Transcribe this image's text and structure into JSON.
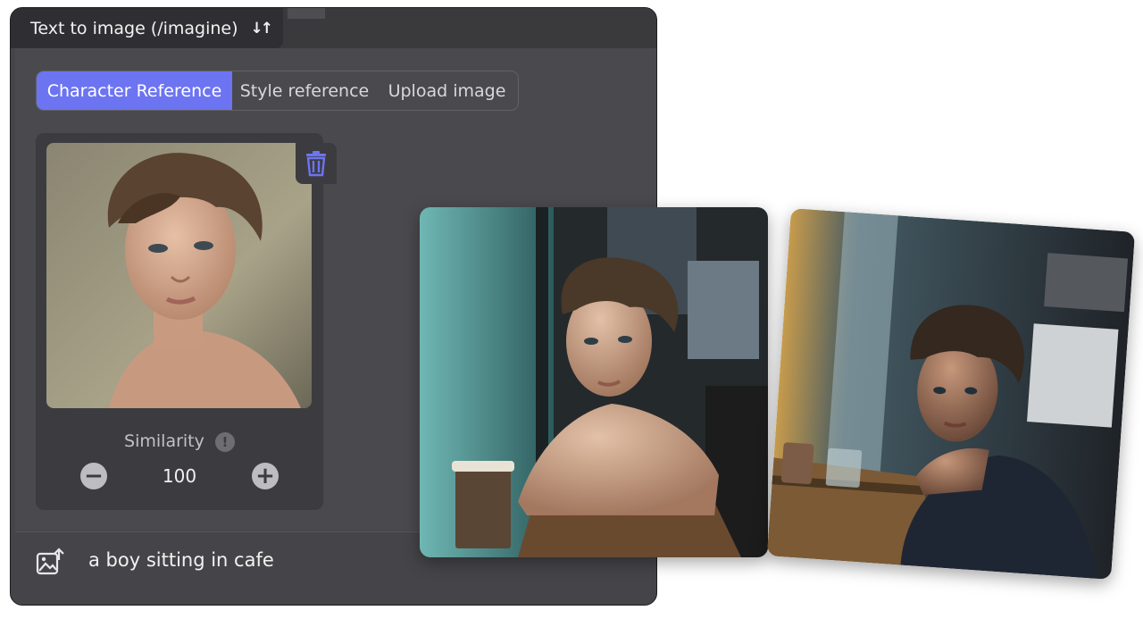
{
  "mode_selector": {
    "label": "Text to image (/imagine)",
    "swap_icon": "swap-vertical-icon"
  },
  "reference_tabs": [
    {
      "label": "Character Reference",
      "active": true
    },
    {
      "label": "Style reference",
      "active": false
    },
    {
      "label": "Upload image",
      "active": false
    }
  ],
  "reference_card": {
    "delete_icon": "trash-icon",
    "similarity_label": "Similarity",
    "info_icon": "info-icon",
    "info_glyph": "!",
    "decrease_glyph": "−",
    "increase_glyph": "+",
    "similarity_value": "100"
  },
  "prompt": {
    "icon": "image-upload-icon",
    "text": "a boy sitting in cafe"
  },
  "colors": {
    "accent": "#6c74f2",
    "panel_bg": "#454549",
    "card_bg": "#3c3c40"
  }
}
